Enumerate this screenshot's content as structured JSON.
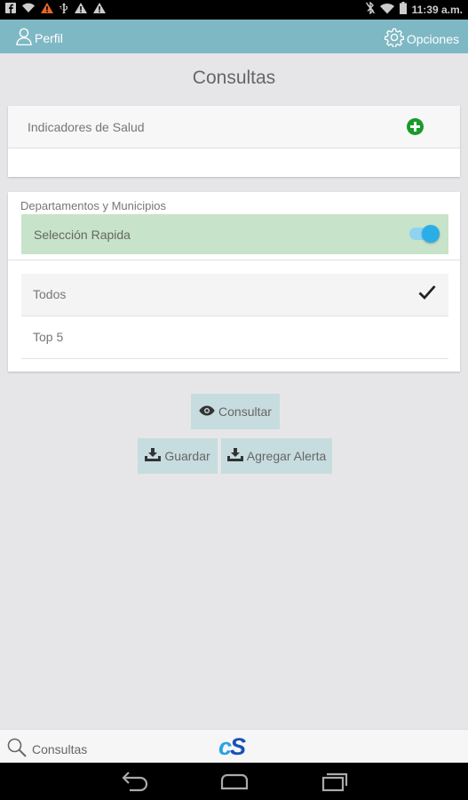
{
  "status_bar": {
    "time": "11:39 a.m."
  },
  "header": {
    "profile_label": "Perfil",
    "options_label": "Opciones"
  },
  "page": {
    "title": "Consultas"
  },
  "health_card": {
    "label": "Indicadores de Salud"
  },
  "departments_card": {
    "title": "Departamentos y Municipios",
    "quick_select_label": "Selección Rapida",
    "quick_select_on": true,
    "options": [
      {
        "label": "Todos",
        "selected": true
      },
      {
        "label": "Top 5",
        "selected": false
      }
    ]
  },
  "actions": {
    "consultar": "Consultar",
    "guardar": "Guardar",
    "agregar_alerta": "Agregar Alerta"
  },
  "bottom_bar": {
    "search_label": "Consultas",
    "logo_c": "c",
    "logo_s": "S"
  },
  "colors": {
    "header": "#7eb8c4",
    "quick_select_bg": "#c7e3c9",
    "toggle_accent": "#29aee8",
    "add_button": "#1a9a2a",
    "action_button": "#c7dcdf"
  }
}
